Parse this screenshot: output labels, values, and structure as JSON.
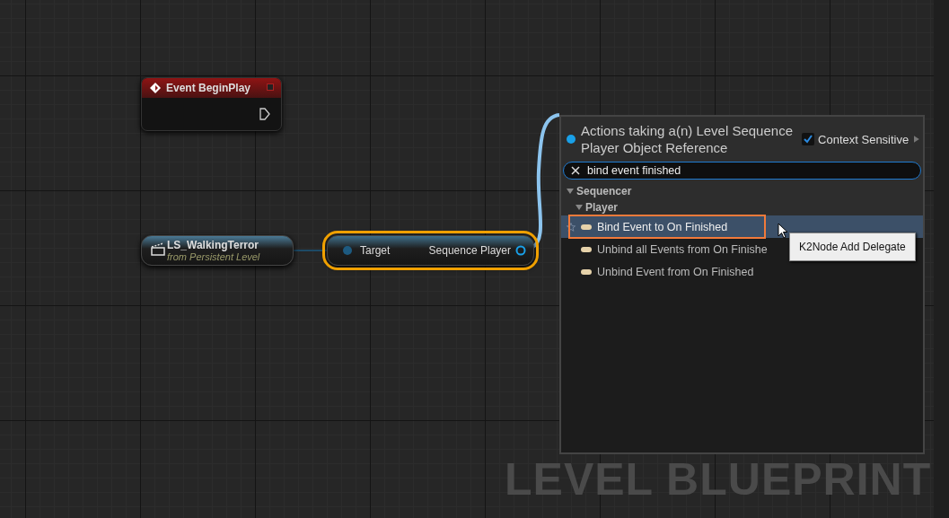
{
  "canvas": {
    "watermark": "LEVEL BLUEPRINT"
  },
  "nodes": [
    {
      "kind": "event",
      "title": "Event BeginPlay",
      "selected": false
    },
    {
      "kind": "actor",
      "title": "LS_WalkingTerror",
      "subtitle": "from Persistent Level",
      "selected": false
    },
    {
      "kind": "function",
      "input": "Target",
      "output": "Sequence Player",
      "selected": true
    }
  ],
  "action_menu": {
    "title": "Actions taking a(n) Level Sequence Player Object Reference",
    "context_sensitive": {
      "label": "Context Sensitive",
      "checked": true
    },
    "search": {
      "value": "bind event finished"
    },
    "tree": [
      {
        "label": "Sequencer",
        "expanded": true,
        "children": [
          {
            "label": "Player",
            "expanded": true,
            "children": [
              {
                "label": "Bind Event to On Finished",
                "selected": true
              },
              {
                "label": "Unbind all Events from On Finishe",
                "selected": false
              },
              {
                "label": "Unbind Event from On Finished",
                "selected": false
              }
            ]
          }
        ]
      }
    ],
    "tooltip": "K2Node Add Delegate"
  }
}
